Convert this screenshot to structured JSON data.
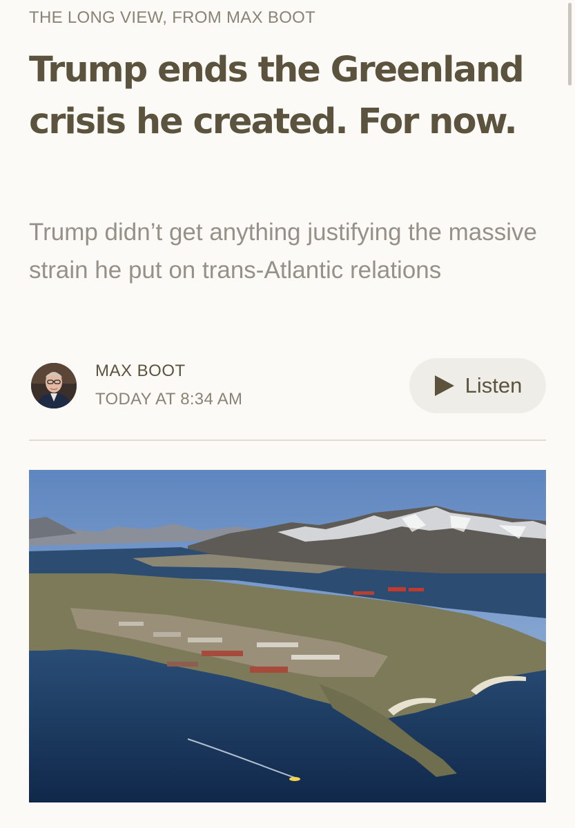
{
  "article": {
    "kicker": "THE LONG VIEW, FROM MAX BOOT",
    "headline": "Trump ends the Greenland crisis he created. For now.",
    "dek": "Trump didn’t get anything justifying the massive strain he put on trans-Atlantic relations"
  },
  "byline": {
    "author": "MAX BOOT",
    "timestamp": "TODAY AT 8:34 AM"
  },
  "listen_button": {
    "label": "Listen",
    "icon": "play-icon"
  },
  "colors": {
    "background": "#fbfaf6",
    "accent": "#5b533e",
    "muted_text": "#969088",
    "button_bg": "#efede7"
  }
}
